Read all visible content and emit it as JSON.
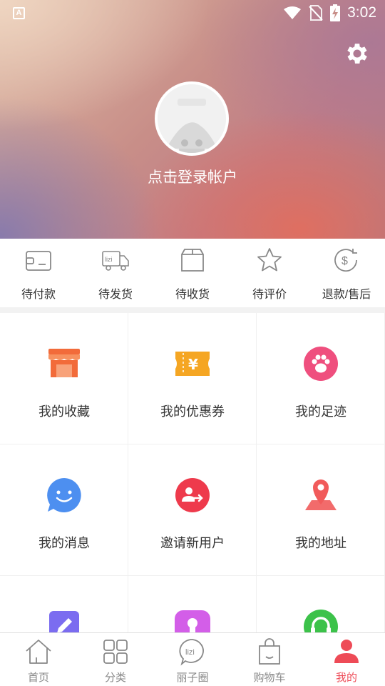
{
  "status_bar": {
    "notification_glyph": "A",
    "time": "3:02"
  },
  "header": {
    "login_prompt": "点击登录帐户"
  },
  "orders": [
    {
      "label": "待付款",
      "icon": "wallet-icon"
    },
    {
      "label": "待发货",
      "icon": "truck-icon"
    },
    {
      "label": "待收货",
      "icon": "box-icon"
    },
    {
      "label": "待评价",
      "icon": "star-icon"
    },
    {
      "label": "退款/售后",
      "icon": "refund-icon"
    }
  ],
  "grid": [
    {
      "label": "我的收藏",
      "icon": "store-icon",
      "color": "#f26b3a"
    },
    {
      "label": "我的优惠券",
      "icon": "coupon-icon",
      "color": "#f5a623"
    },
    {
      "label": "我的足迹",
      "icon": "paw-icon",
      "color": "#ef4f7e"
    },
    {
      "label": "我的消息",
      "icon": "chat-icon",
      "color": "#4d8ff0"
    },
    {
      "label": "邀请新用户",
      "icon": "invite-icon",
      "color": "#ee3a4c"
    },
    {
      "label": "我的地址",
      "icon": "location-icon",
      "color": "#f15b5b"
    },
    {
      "label": "",
      "icon": "edit-icon",
      "color": "#7b6cf0"
    },
    {
      "label": "",
      "icon": "profile-icon",
      "color": "#d35ee8"
    },
    {
      "label": "",
      "icon": "headset-icon",
      "color": "#3cc24a"
    }
  ],
  "tabs": [
    {
      "label": "首页",
      "icon": "home-icon"
    },
    {
      "label": "分类",
      "icon": "category-icon"
    },
    {
      "label": "丽子圈",
      "icon": "lizi-circle-icon",
      "icon_text": "lizi"
    },
    {
      "label": "购物车",
      "icon": "cart-bag-icon"
    },
    {
      "label": "我的",
      "icon": "user-icon",
      "active": true
    }
  ],
  "colors": {
    "accent": "#ee4b57",
    "icon_gray": "#888888"
  }
}
